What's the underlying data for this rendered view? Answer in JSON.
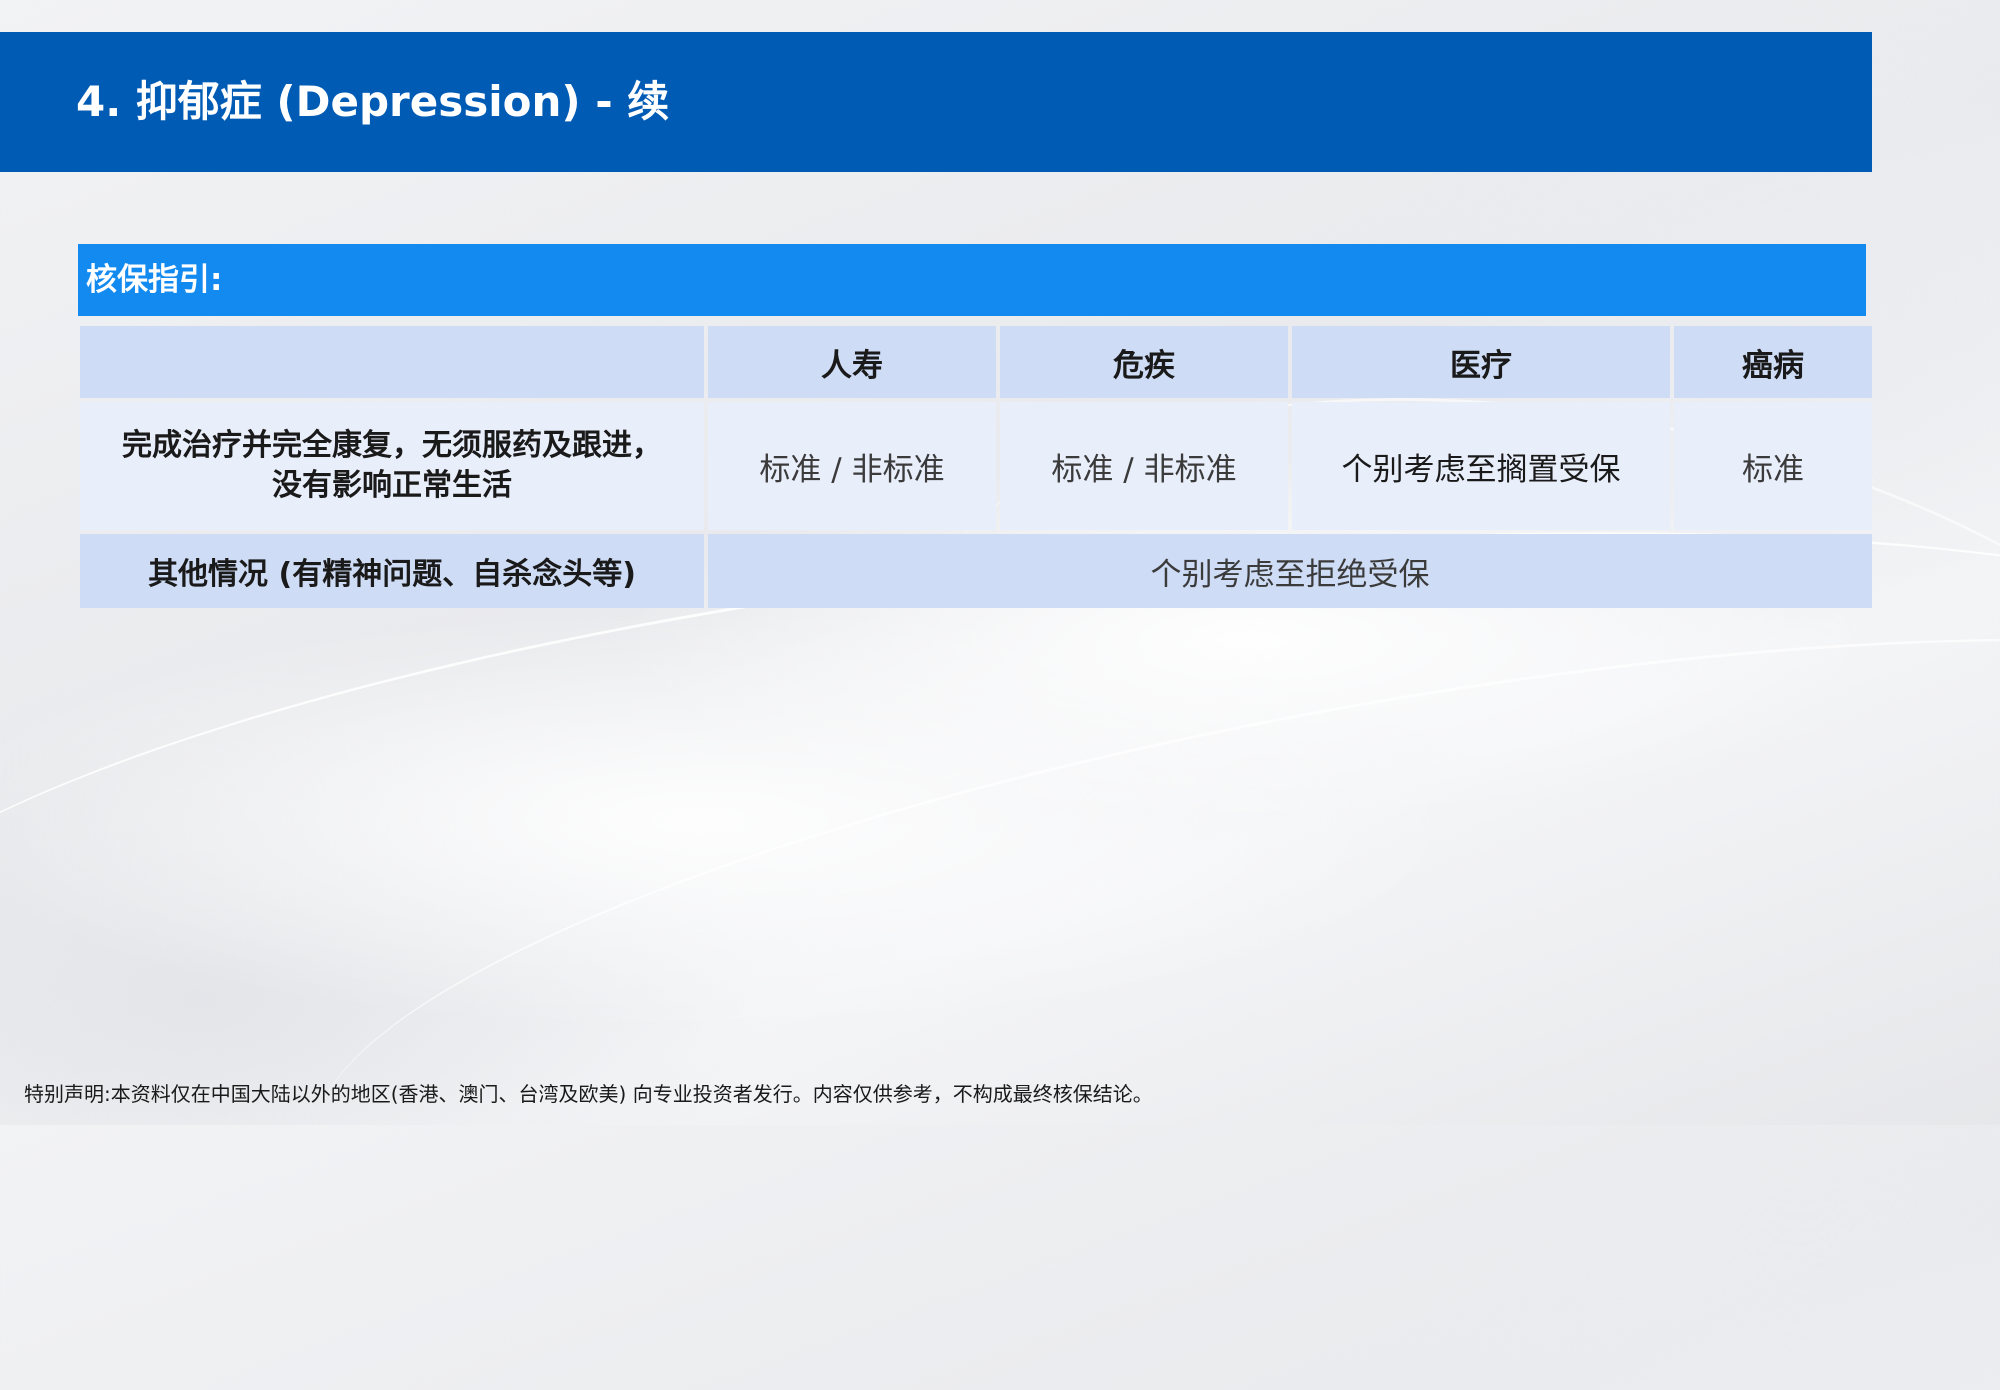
{
  "header": {
    "title": "4. 抑郁症 (Depression) - 续"
  },
  "guide": {
    "label": "核保指引:"
  },
  "table": {
    "columns": [
      "",
      "人寿",
      "危疾",
      "医疗",
      "癌病"
    ],
    "rows": [
      {
        "label": "完成治疗并完全康复，无须服药及跟进，没有影响正常生活",
        "cells": [
          "标准 / 非标准",
          "标准 / 非标准",
          "个别考虑至搁置受保",
          "标准"
        ]
      },
      {
        "label": "其他情况 (有精神问题、自杀念头等)",
        "merged": "个别考虑至拒绝受保"
      }
    ]
  },
  "footer": {
    "disclaimer": "特别声明:本资料仅在中国大陆以外的地区(香港、澳门、台湾及欧美) 向专业投资者发行。内容仅供参考，不构成最终核保结论。"
  },
  "colors": {
    "header_band": "#005bb5",
    "guide_bar": "#138af0",
    "table_header": "#cfdcf6",
    "table_row_light": "#e9eefb"
  }
}
